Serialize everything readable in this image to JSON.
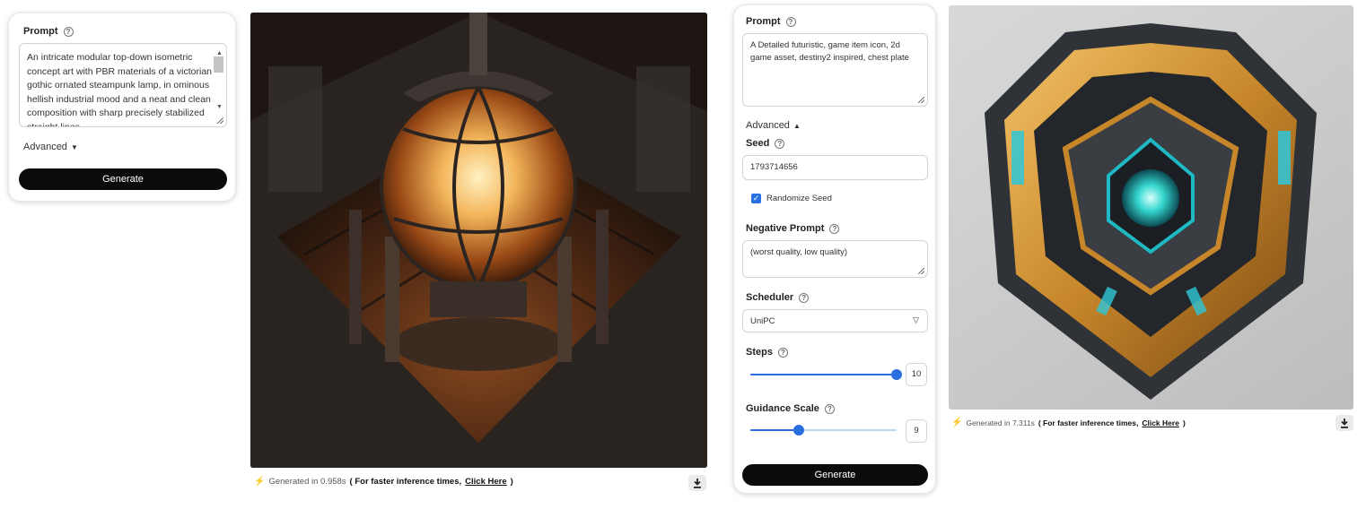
{
  "panel_left": {
    "prompt_label": "Prompt",
    "prompt_value": "An intricate modular top-down isometric concept art with PBR materials of a victorian gothic ornated steampunk lamp, in ominous hellish industrial mood and a neat and clean composition with sharp precisely stabilized straight lines",
    "advanced_label": "Advanced",
    "generate_label": "Generate"
  },
  "result_left": {
    "image_icon": "steampunk-lamp-image",
    "generated_prefix": "Generated in 0.958s",
    "faster_text": "( For faster inference times,",
    "click_here": "Click Here",
    "close_paren": ")"
  },
  "panel_right": {
    "prompt_label": "Prompt",
    "prompt_value": "A Detailed futuristic, game item icon, 2d game asset, destiny2 inspired, chest plate",
    "advanced_label": "Advanced",
    "seed_label": "Seed",
    "seed_value": "1793714656",
    "randomize_seed_label": "Randomize Seed",
    "randomize_seed_checked": true,
    "negative_prompt_label": "Negative Prompt",
    "negative_prompt_value": "(worst quality, low quality)",
    "scheduler_label": "Scheduler",
    "scheduler_value": "UniPC",
    "steps_label": "Steps",
    "steps_value": "10",
    "steps_fraction": 1.0,
    "guidance_label": "Guidance Scale",
    "guidance_value": "9",
    "guidance_fraction": 0.33,
    "generate_label": "Generate"
  },
  "result_right": {
    "image_icon": "chest-plate-image",
    "generated_prefix": "Generated in 7.311s",
    "faster_text": "( For faster inference times,",
    "click_here": "Click Here",
    "close_paren": ")"
  },
  "colors": {
    "accent": "#2a6fe0",
    "button": "#0b0b0b",
    "bolt": "#f08a1c"
  }
}
